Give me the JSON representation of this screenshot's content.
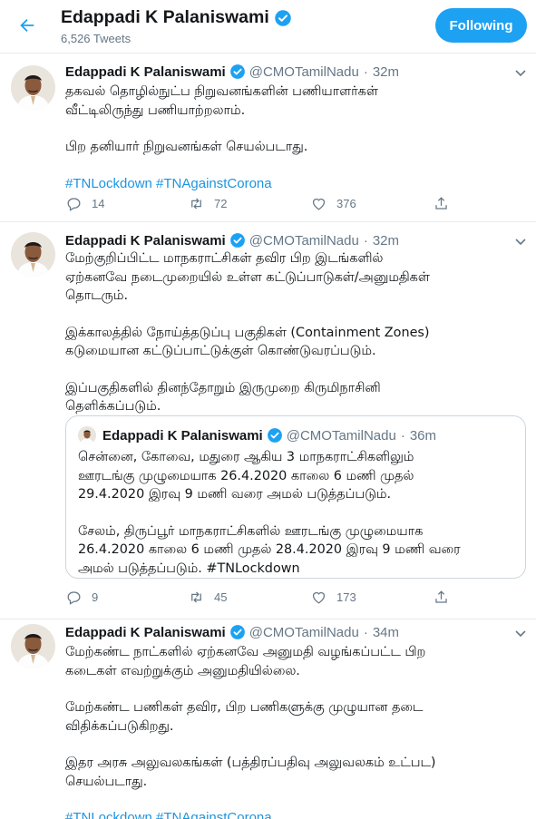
{
  "header": {
    "name": "Edappadi K Palaniswami",
    "tweet_count": "6,526 Tweets",
    "follow_label": "Following"
  },
  "colors": {
    "accent": "#1da1f2",
    "link": "#1b95e0",
    "muted": "#657786",
    "border": "#e6ecf0"
  },
  "tweets": [
    {
      "name": "Edappadi K Palaniswami",
      "handle": "@CMOTamilNadu",
      "dot": "·",
      "time": "32m",
      "paragraphs": [
        "தகவல் தொழில்நுட்ப நிறுவனங்களின் பணியாளர்கள்\nவீட்டிலிருந்து பணியாற்றலாம்.",
        "பிற தனியார் நிறுவனங்கள் செயல்படாது."
      ],
      "hashtags": "#TNLockdown #TNAgainstCorona",
      "replies": "14",
      "retweets": "72",
      "likes": "376"
    },
    {
      "name": "Edappadi K Palaniswami",
      "handle": "@CMOTamilNadu",
      "dot": "·",
      "time": "32m",
      "paragraphs": [
        "மேற்குறிப்பிட்ட மாநகராட்சிகள் தவிர பிற இடங்களில்\nஏற்கனவே நடைமுறையில் உள்ள கட்டுப்பாடுகள்/அனுமதிகள்\nதொடரும்.",
        "இக்காலத்தில் நோய்த்தடுப்பு பகுதிகள் (Containment Zones)\nகடுமையான கட்டுப்பாட்டுக்குள் கொண்டுவரப்படும்.",
        "இப்பகுதிகளில் தினந்தோறும் இருமுறை கிருமிநாசினி\nதெளிக்கப்படும்."
      ],
      "quote": {
        "name": "Edappadi K Palaniswami",
        "handle": "@CMOTamilNadu",
        "dot": "·",
        "time": "36m",
        "paragraphs": [
          "சென்னை, கோவை, மதுரை ஆகிய 3 மாநகராட்சிகளிலும்\nஊரடங்கு முழுமையாக 26.4.2020 காலை 6 மணி முதல்\n29.4.2020 இரவு 9 மணி வரை அமல் படுத்தப்படும்.",
          "சேலம், திருப்பூர் மாநகராட்சிகளில் ஊரடங்கு முழுமையாக\n26.4.2020 காலை 6 மணி முதல் 28.4.2020 இரவு 9 மணி வரை\nஅமல் படுத்தப்படும். #TNLockdown"
        ]
      },
      "replies": "9",
      "retweets": "45",
      "likes": "173"
    },
    {
      "name": "Edappadi K Palaniswami",
      "handle": "@CMOTamilNadu",
      "dot": "·",
      "time": "34m",
      "paragraphs": [
        "மேற்கண்ட நாட்களில் ஏற்கனவே அனுமதி வழங்கப்பட்ட பிற\nகடைகள் எவற்றுக்கும் அனுமதியில்லை.",
        "மேற்கண்ட பணிகள் தவிர, பிற பணிகளுக்கு முழுயான தடை\nவிதிக்கப்படுகிறது.",
        "இதர அரசு அலுவலகங்கள் (பத்திரப்பதிவு அலுவலகம் உட்பட)\nசெயல்படாது."
      ],
      "hashtags": "#TNLockdown #TNAgainstCorona"
    }
  ]
}
